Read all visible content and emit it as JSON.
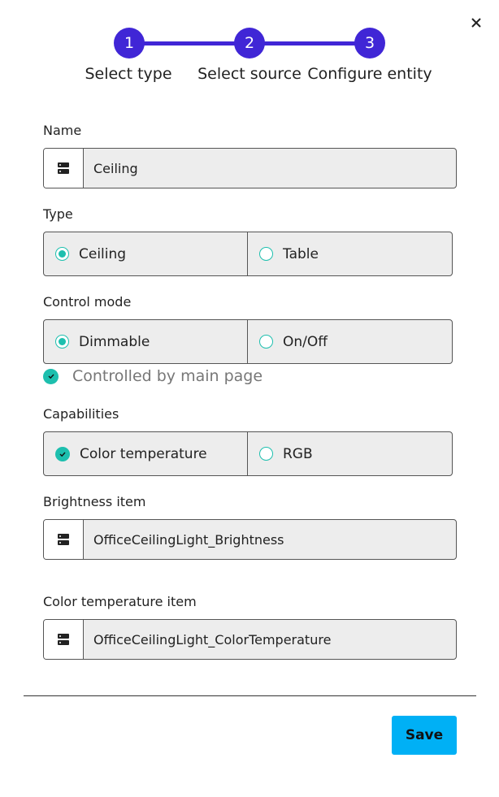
{
  "stepper": {
    "steps": [
      {
        "number": "1",
        "label": "Select type"
      },
      {
        "number": "2",
        "label": "Select source"
      },
      {
        "number": "3",
        "label": "Configure entity"
      }
    ]
  },
  "form": {
    "name": {
      "label": "Name",
      "value": "Ceiling",
      "icon": "server-icon"
    },
    "type": {
      "label": "Type",
      "options": [
        "Ceiling",
        "Table"
      ],
      "selected": "Ceiling"
    },
    "control_mode": {
      "label": "Control mode",
      "options": [
        "Dimmable",
        "On/Off"
      ],
      "selected": "Dimmable"
    },
    "controlled_by_main": {
      "label": "Controlled by main page",
      "checked": true
    },
    "capabilities": {
      "label": "Capabilities",
      "options": [
        "Color temperature",
        "RGB"
      ],
      "selected": "Color temperature"
    },
    "brightness_item": {
      "label": "Brightness item",
      "value": "OfficeCeilingLight_Brightness",
      "icon": "server-icon"
    },
    "color_temperature_item": {
      "label": "Color temperature item",
      "value": "OfficeCeilingLight_ColorTemperature",
      "icon": "server-icon"
    }
  },
  "footer": {
    "save_label": "Save"
  },
  "colors": {
    "accent": "#4026d6",
    "teal": "#1dbfae",
    "save": "#00b0f5"
  }
}
